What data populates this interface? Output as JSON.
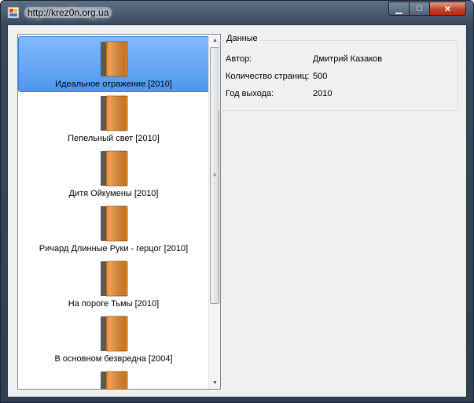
{
  "window": {
    "title": "http://krez0n.org.ua",
    "controls": {
      "minimize": "▁",
      "maximize": "□",
      "close": "✕"
    }
  },
  "book_list": {
    "selected_index": 0,
    "items": [
      {
        "label": "Идеальное отражение [2010]",
        "icon": "book-icon"
      },
      {
        "label": "Пепельный свет [2010]",
        "icon": "book-icon"
      },
      {
        "label": "Дитя Ойкумены [2010]",
        "icon": "book-icon"
      },
      {
        "label": "Ричард Длинные Руки - герцог [2010]",
        "icon": "book-icon"
      },
      {
        "label": "На пороге Тьмы [2010]",
        "icon": "book-icon"
      },
      {
        "label": "В основном безвредна [2004]",
        "icon": "book-icon"
      },
      {
        "label": "",
        "icon": "book-icon"
      }
    ],
    "scrollbar": {
      "up": "▲",
      "down": "▼",
      "grip": "≡"
    }
  },
  "details": {
    "group_title": "Данные",
    "author_label": "Автор:",
    "author_value": "Дмитрий Казаков",
    "pages_label": "Количество страниц:",
    "pages_value": "500",
    "year_label": "Год выхода:",
    "year_value": "2010"
  },
  "colors": {
    "selection": "#5ea3f3",
    "book_cover": "#e8892b",
    "book_spine": "#5a5a5a"
  }
}
